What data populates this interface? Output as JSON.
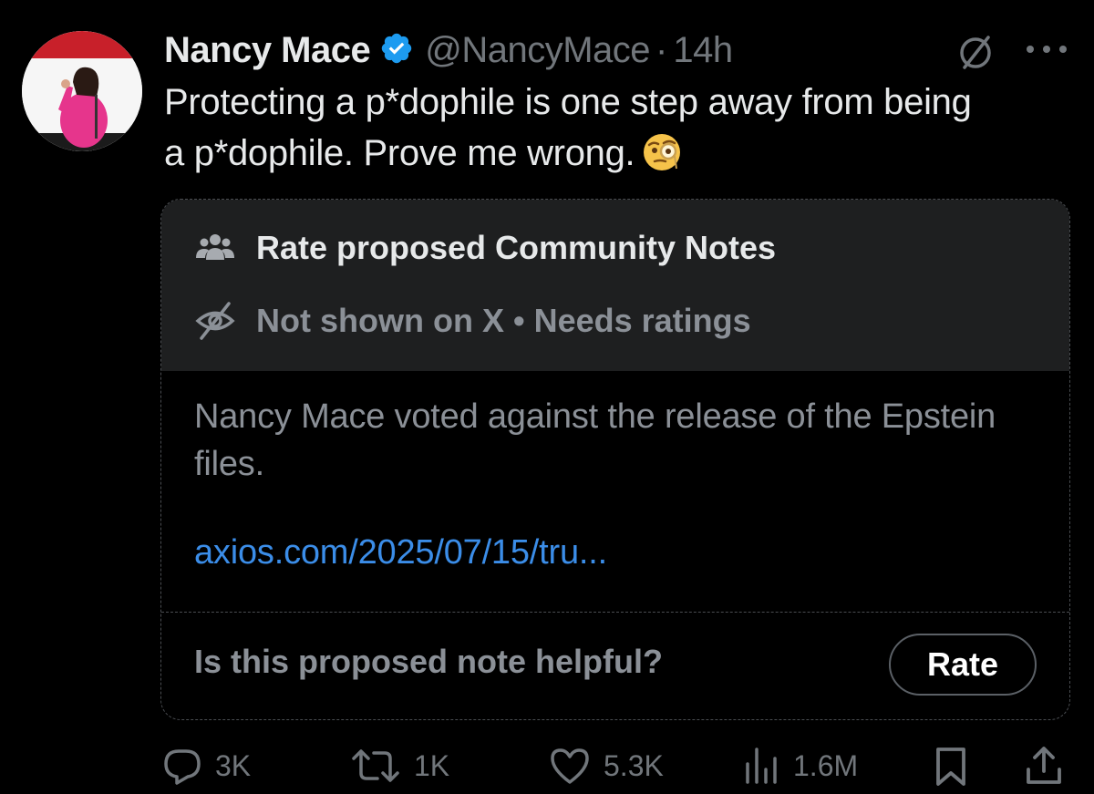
{
  "author": {
    "display_name": "Nancy Mace",
    "handle": "@NancyMace",
    "separator": "·",
    "time": "14h",
    "verified": true
  },
  "tweet": {
    "line1": "Protecting a p*dophile is one step away from being",
    "line2": "a p*dophile. Prove me wrong.",
    "emoji": "face-with-monocle"
  },
  "community_note": {
    "header_title": "Rate proposed Community Notes",
    "status": "Not shown on X • Needs ratings",
    "body": "Nancy Mace voted against the release of the Epstein files.",
    "link": "axios.com/2025/07/15/tru...",
    "question": "Is this proposed note helpful?",
    "rate_label": "Rate"
  },
  "actions": {
    "replies": "3K",
    "reposts": "1K",
    "likes": "5.3K",
    "views": "1.6M"
  },
  "colors": {
    "background": "#000000",
    "primary_text": "#e7e9ea",
    "secondary_text": "#71767b",
    "link": "#3b8de8",
    "verified": "#1d9bf0",
    "note_header_bg": "#1e1f20"
  },
  "icons": [
    "verified-badge-icon",
    "grok-icon",
    "more-icon",
    "people-icon",
    "eye-off-icon",
    "reply-icon",
    "repost-icon",
    "like-icon",
    "views-icon",
    "bookmark-icon",
    "share-icon"
  ]
}
